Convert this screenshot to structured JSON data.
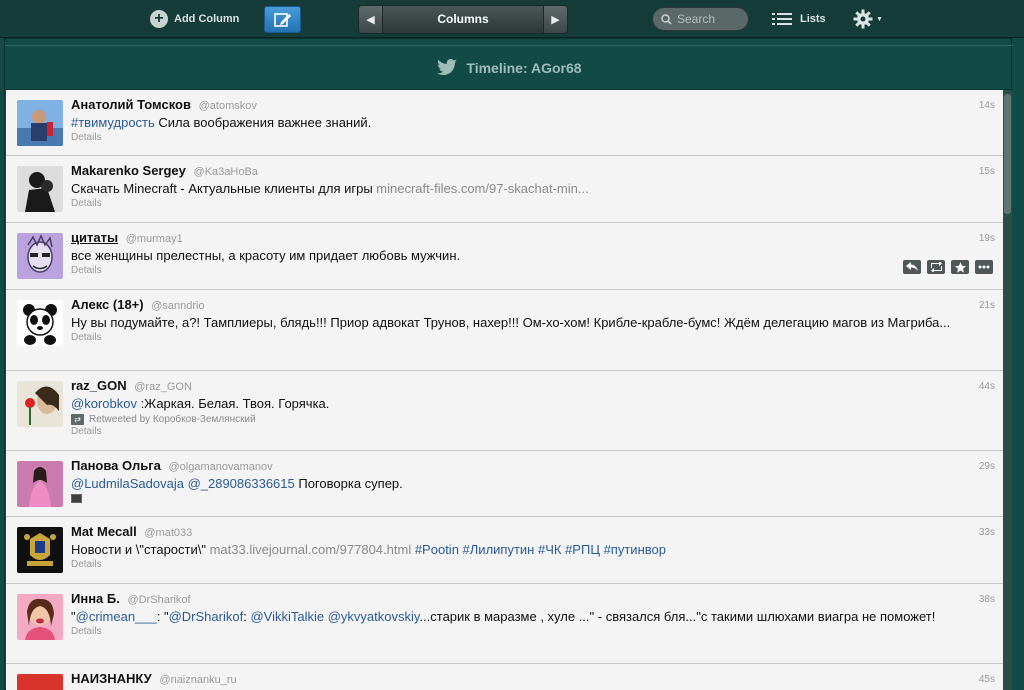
{
  "toolbar": {
    "add_column_label": "Add Column",
    "columns_label": "Columns",
    "search_placeholder": "Search",
    "lists_label": "Lists"
  },
  "column": {
    "title": "Timeline: AGor68"
  },
  "tweets": [
    {
      "name": "Анатолий Томсков",
      "handle": "@atomskov",
      "time": "14s",
      "text_parts": [
        "#твимудрость",
        " Сила воображения важнее знаний."
      ],
      "details": "Details"
    },
    {
      "name": "Makarenko Sergey",
      "handle": "@Ka3aHoBa",
      "time": "15s",
      "text_parts": [
        "Скачать Minecraft - Актуальные клиенты для игры ",
        "minecraft-files.com/97-skachat-min..."
      ],
      "details": "Details"
    },
    {
      "name": "цитаты",
      "handle": "@murmay1",
      "time": "19s",
      "text_parts": [
        "все женщины прелестны, а красоту им придает любовь мужчин."
      ],
      "details": "Details"
    },
    {
      "name": "Алекс (18+)",
      "handle": "@sanndrio",
      "time": "21s",
      "text_parts": [
        "Ну вы подумайте, а?! Тамплиеры, блядь!!! Приор адвокат Трунов, нахер!!! Ом-хо-хом! Крибле-крабле-бумс! Ждём делегацию магов из Магриба..."
      ],
      "details": "Details"
    },
    {
      "name": "raz_GON",
      "handle": "@raz_GON",
      "time": "44s",
      "text_parts": [
        "@korobkov",
        " :Жаркая. Белая. Твоя. Горячка."
      ],
      "retweeted_by": "Retweeted by Коробков-Землянский",
      "details": "Details"
    },
    {
      "name": "Панова Ольга",
      "handle": "@olgamanovamanov",
      "time": "29s",
      "text_parts": [
        "@LudmilaSadovaja",
        " ",
        "@_289086336615",
        " Поговорка супер."
      ]
    },
    {
      "name": "Mat Mecall",
      "handle": "@mat033",
      "time": "33s",
      "text_parts": [
        "Новости и \\\"старости\\\" ",
        "mat33.livejournal.com/977804.html",
        " ",
        "#Pootin",
        " ",
        "#Лилипутин",
        " ",
        "#ЧК",
        " ",
        "#РПЦ",
        " ",
        "#путинвор"
      ],
      "details": "Details"
    },
    {
      "name": "Инна Б.",
      "handle": "@DrSharikof",
      "time": "38s",
      "text_parts": [
        "\"",
        "@crimean___",
        ": \"",
        "@DrSharikof",
        ": ",
        "@VikkiTalkie",
        " ",
        "@ykvyatkovskiy",
        "...старик в маразме , хуле ...\" - связался бля...\"с такими шлюхами виагра не поможет!"
      ],
      "details": "Details"
    },
    {
      "name": "НАИЗНАНКУ",
      "handle": "@naiznanku_ru",
      "time": "45s"
    }
  ],
  "colors": {
    "background": "#124a45",
    "toolbar": "#153c38",
    "compose_button": "#2a7fc4",
    "timeline_bg": "#f4f4f4",
    "link": "#2b5b95",
    "url": "#8a8a8a"
  },
  "icons": [
    "plus-icon",
    "compose-icon",
    "chevron-left-icon",
    "chevron-right-icon",
    "search-icon",
    "lists-icon",
    "gear-icon",
    "twitter-bird-icon",
    "reply-icon",
    "retweet-icon",
    "favorite-icon",
    "more-icon"
  ]
}
